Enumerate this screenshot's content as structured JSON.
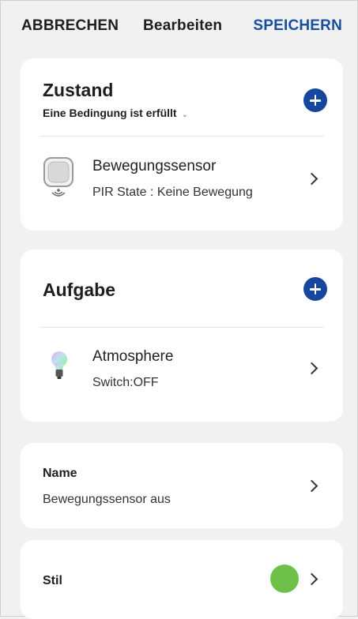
{
  "header": {
    "cancel_label": "ABBRECHEN",
    "title": "Bearbeiten",
    "save_label": "SPEICHERN"
  },
  "condition": {
    "title": "Zustand",
    "subtitle": "Eine Bedingung ist erfüllt",
    "item": {
      "icon": "motion-sensor-icon",
      "title": "Bewegungssensor",
      "detail": "PIR State : Keine Bewegung"
    }
  },
  "task": {
    "title": "Aufgabe",
    "item": {
      "icon": "rgb-bulb-icon",
      "title": "Atmosphere",
      "detail": "Switch:OFF"
    }
  },
  "name": {
    "label": "Name",
    "value": "Bewegungssensor aus"
  },
  "style": {
    "label": "Stil",
    "color": "#6dc14a"
  },
  "colors": {
    "accent": "#16469d",
    "save_text": "#1a4fa0",
    "background": "#f1f1f1",
    "card": "#ffffff"
  }
}
